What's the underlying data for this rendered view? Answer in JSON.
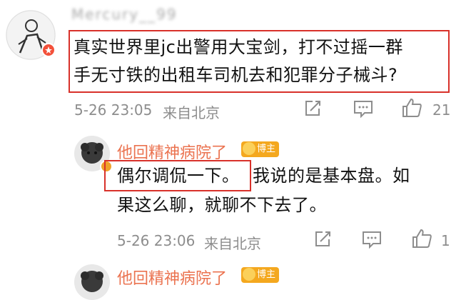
{
  "comment1": {
    "username_blurred": "Mercury__99",
    "text_line1": "真实世界里jc出警用大宝剑，打不过摇一群",
    "text_line2": "手无寸铁的出租车司机去和犯罪分子械斗?",
    "time": "5-26 23:05",
    "source": "来自北京",
    "like_count": "21"
  },
  "reply1": {
    "name": "他回精神病院了",
    "badge": "博主",
    "text_boxed": "偶尔调侃一下。",
    "text_rest": "我说的是基本盘。如",
    "text_line2": "果这么聊，就聊不下去了。",
    "time": "5-26 23:06",
    "source": "来自北京",
    "like_count": "1"
  },
  "reply2": {
    "name": "他回精神病院了",
    "badge": "博主"
  },
  "icons": {
    "share": "share-icon",
    "comment": "comment-icon",
    "like": "like-icon"
  },
  "colors": {
    "highlight_box": "#d8312a",
    "name": "#eb7350",
    "meta": "#8d8d8d",
    "badge": "#f4a81f"
  }
}
